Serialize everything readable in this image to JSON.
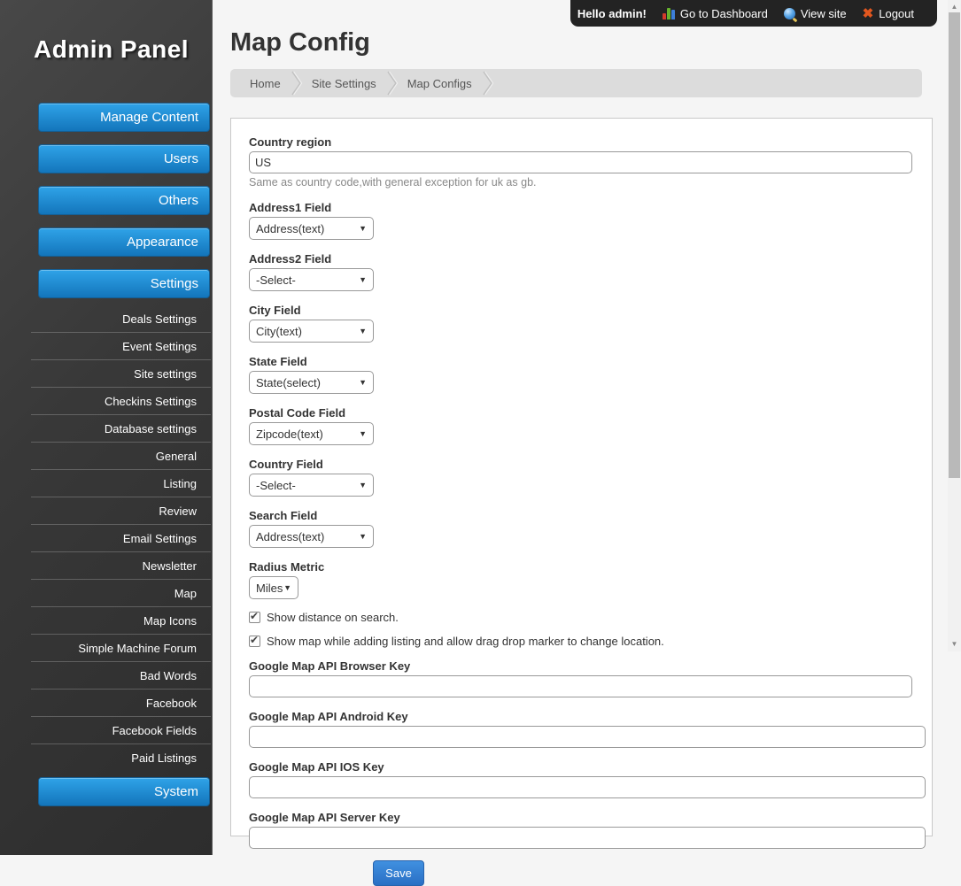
{
  "topbar": {
    "greeting": "Hello admin!",
    "dashboard_label": "Go to Dashboard",
    "view_site_label": "View site",
    "logout_label": "Logout",
    "logout_icon_glyph": "✖"
  },
  "sidebar": {
    "title": "Admin Panel",
    "buttons": [
      "Manage Content",
      "Users",
      "Others",
      "Appearance",
      "Settings"
    ],
    "settings_items": [
      "Deals Settings",
      "Event Settings",
      "Site settings",
      "Checkins Settings",
      "Database settings",
      "General",
      "Listing",
      "Review",
      "Email Settings",
      "Newsletter",
      "Map",
      "Map Icons",
      "Simple Machine Forum",
      "Bad Words",
      "Facebook",
      "Facebook Fields",
      "Paid Listings"
    ],
    "system_button": "System"
  },
  "main": {
    "title": "Map Config",
    "breadcrumb": [
      "Home",
      "Site Settings",
      "Map Configs"
    ],
    "form": {
      "country_region": {
        "label": "Country region",
        "value": "US",
        "help": "Same as country code,with general exception for uk as gb."
      },
      "selects": [
        {
          "label": "Address1 Field",
          "value": "Address(text)"
        },
        {
          "label": "Address2 Field",
          "value": "-Select-"
        },
        {
          "label": "City Field",
          "value": "City(text)"
        },
        {
          "label": "State Field",
          "value": "State(select)"
        },
        {
          "label": "Postal Code Field",
          "value": "Zipcode(text)"
        },
        {
          "label": "Country Field",
          "value": "-Select-"
        },
        {
          "label": "Search Field",
          "value": "Address(text)"
        }
      ],
      "radius_metric": {
        "label": "Radius Metric",
        "value": "Miles"
      },
      "checkboxes": [
        {
          "label": "Show distance on search.",
          "checked": true
        },
        {
          "label": "Show map while adding listing and allow drag drop marker to change location.",
          "checked": true
        }
      ],
      "api_keys": [
        {
          "label": "Google Map API Browser Key",
          "value": ""
        },
        {
          "label": "Google Map API Android Key",
          "value": ""
        },
        {
          "label": "Google Map API IOS Key",
          "value": ""
        },
        {
          "label": "Google Map API Server Key",
          "value": ""
        }
      ],
      "save_label": "Save"
    }
  },
  "colors": {
    "sidebar_bg": "#3a3a3a",
    "accent_blue": "#1f86cd",
    "topbar_bg": "#232323",
    "breadcrumb_bg": "#dcdcdc",
    "panel_border": "#c8c8c8",
    "save_blue": "#2f7fd3",
    "logout_orange": "#e2571f",
    "chart_red": "#d33a2c",
    "chart_green": "#67b32e",
    "chart_blue": "#3d7fd9"
  }
}
